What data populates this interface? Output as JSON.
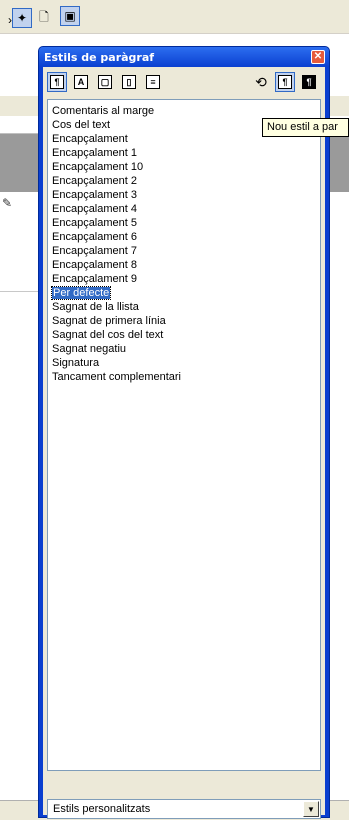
{
  "window": {
    "title": "Estils de paràgraf",
    "close_label": "✕"
  },
  "toolbar": {
    "icons": [
      "paragraph-styles-icon",
      "character-styles-icon",
      "frame-styles-icon",
      "page-styles-icon",
      "list-styles-icon",
      "fill-format-icon",
      "new-style-from-selection-icon",
      "update-style-icon"
    ]
  },
  "styles_list": {
    "items": [
      "Comentaris al marge",
      "Cos del text",
      "Encapçalament",
      "Encapçalament 1",
      "Encapçalament 10",
      "Encapçalament 2",
      "Encapçalament 3",
      "Encapçalament 4",
      "Encapçalament 5",
      "Encapçalament 6",
      "Encapçalament 7",
      "Encapçalament 8",
      "Encapçalament 9",
      "Per defecte",
      "Sagnat de la llista",
      "Sagnat de primera línia",
      "Sagnat del cos del text",
      "Sagnat negatiu",
      "Signatura",
      "Tancament complementari"
    ],
    "selected": "Per defecte"
  },
  "tooltip": {
    "text": "Nou estil a par"
  },
  "filter": {
    "selected": "Estils personalitzats"
  },
  "colors": {
    "titlebar": "#0a3fd0",
    "selection": "#316ac5",
    "tooltip_bg": "#ffffe1"
  }
}
